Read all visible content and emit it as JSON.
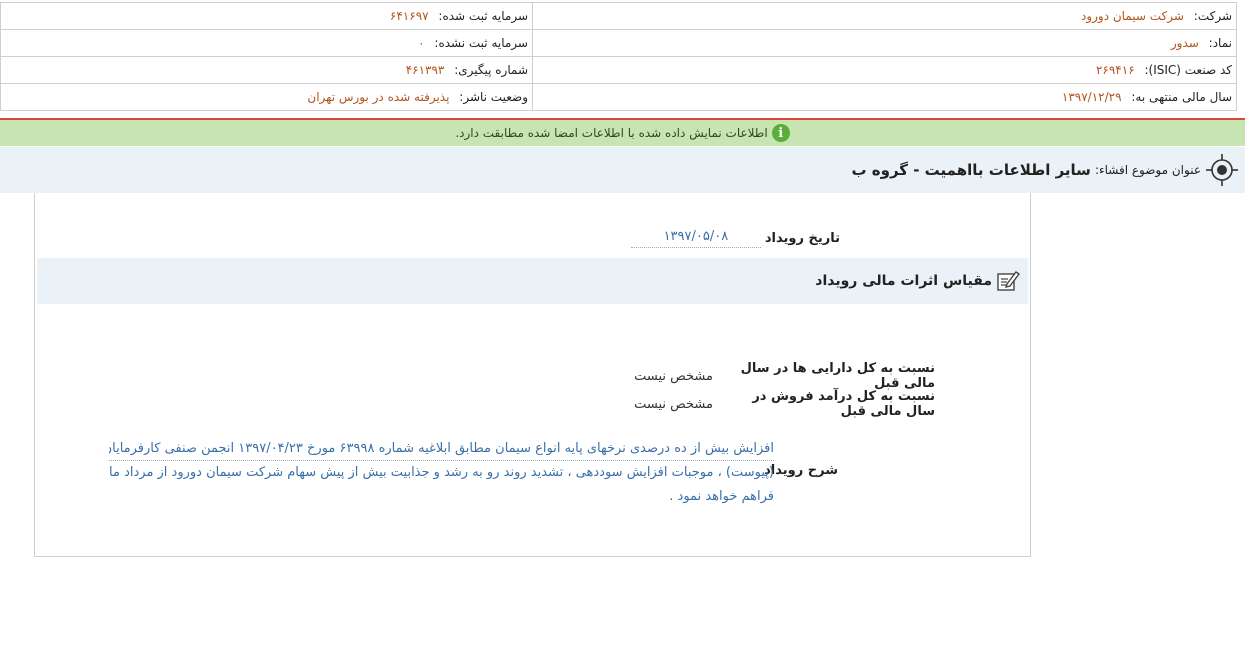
{
  "company_info": {
    "company_label": "شرکت:",
    "company_value": "شرکت سیمان دورود",
    "registered_capital_label": "سرمایه ثبت شده:",
    "registered_capital_value": "۶۴۱۶۹۷",
    "symbol_label": "نماد:",
    "symbol_value": "سدور",
    "unregistered_capital_label": "سرمایه ثبت نشده:",
    "unregistered_capital_value": "۰",
    "isic_label": "کد صنعت (ISIC):",
    "isic_value": "۲۶۹۴۱۶",
    "tracking_label": "شماره پیگیری:",
    "tracking_value": "۴۶۱۳۹۳",
    "fiscal_year_label": "سال مالی منتهی به:",
    "fiscal_year_value": "۱۳۹۷/۱۲/۲۹",
    "publisher_status_label": "وضعیت ناشر:",
    "publisher_status_value": "پذیرفته شده در بورس تهران"
  },
  "notice": {
    "icon": "info-icon",
    "text": "اطلاعات نمایش داده شده با اطلاعات امضا شده مطابقت دارد."
  },
  "subject": {
    "icon": "target-icon",
    "label": "عنوان موضوع افشاء:",
    "title": "سایر اطلاعات بااهمیت - گروه ب"
  },
  "event": {
    "date_label": "تاریخ رویداد",
    "date_value": "۱۳۹۷/۰۵/۰۸"
  },
  "financial_section": {
    "icon": "edit-icon",
    "title": "مقیاس اثرات مالی رویداد",
    "rows": [
      {
        "label": "نسبت به کل دارایی ها در سال مالی قبل",
        "value": "مشخص نیست"
      },
      {
        "label": "نسبت به کل درآمد فروش در سال مالی قبل",
        "value": "مشخص نیست"
      }
    ]
  },
  "description": {
    "label": "شرح رویداد",
    "lines": [
      "افزایش بیش از ده درصدی نرخهای پایه انواع سیمان مطابق ابلاغیه شماره ۶۳۹۹۸ مورخ ۱۳۹۷/۰۴/۲۳ انجمن صنفی کارفرمایان صنعت سیمان",
      "(پیوست) ، موجبات افزایش سوددهی ، تشدید روند رو به رشد و جذابیت بیش از پیش سهام شرکت سیمان دورود از مرداد ماه سال جاری را",
      "فراهم خواهد نمود ."
    ]
  }
}
